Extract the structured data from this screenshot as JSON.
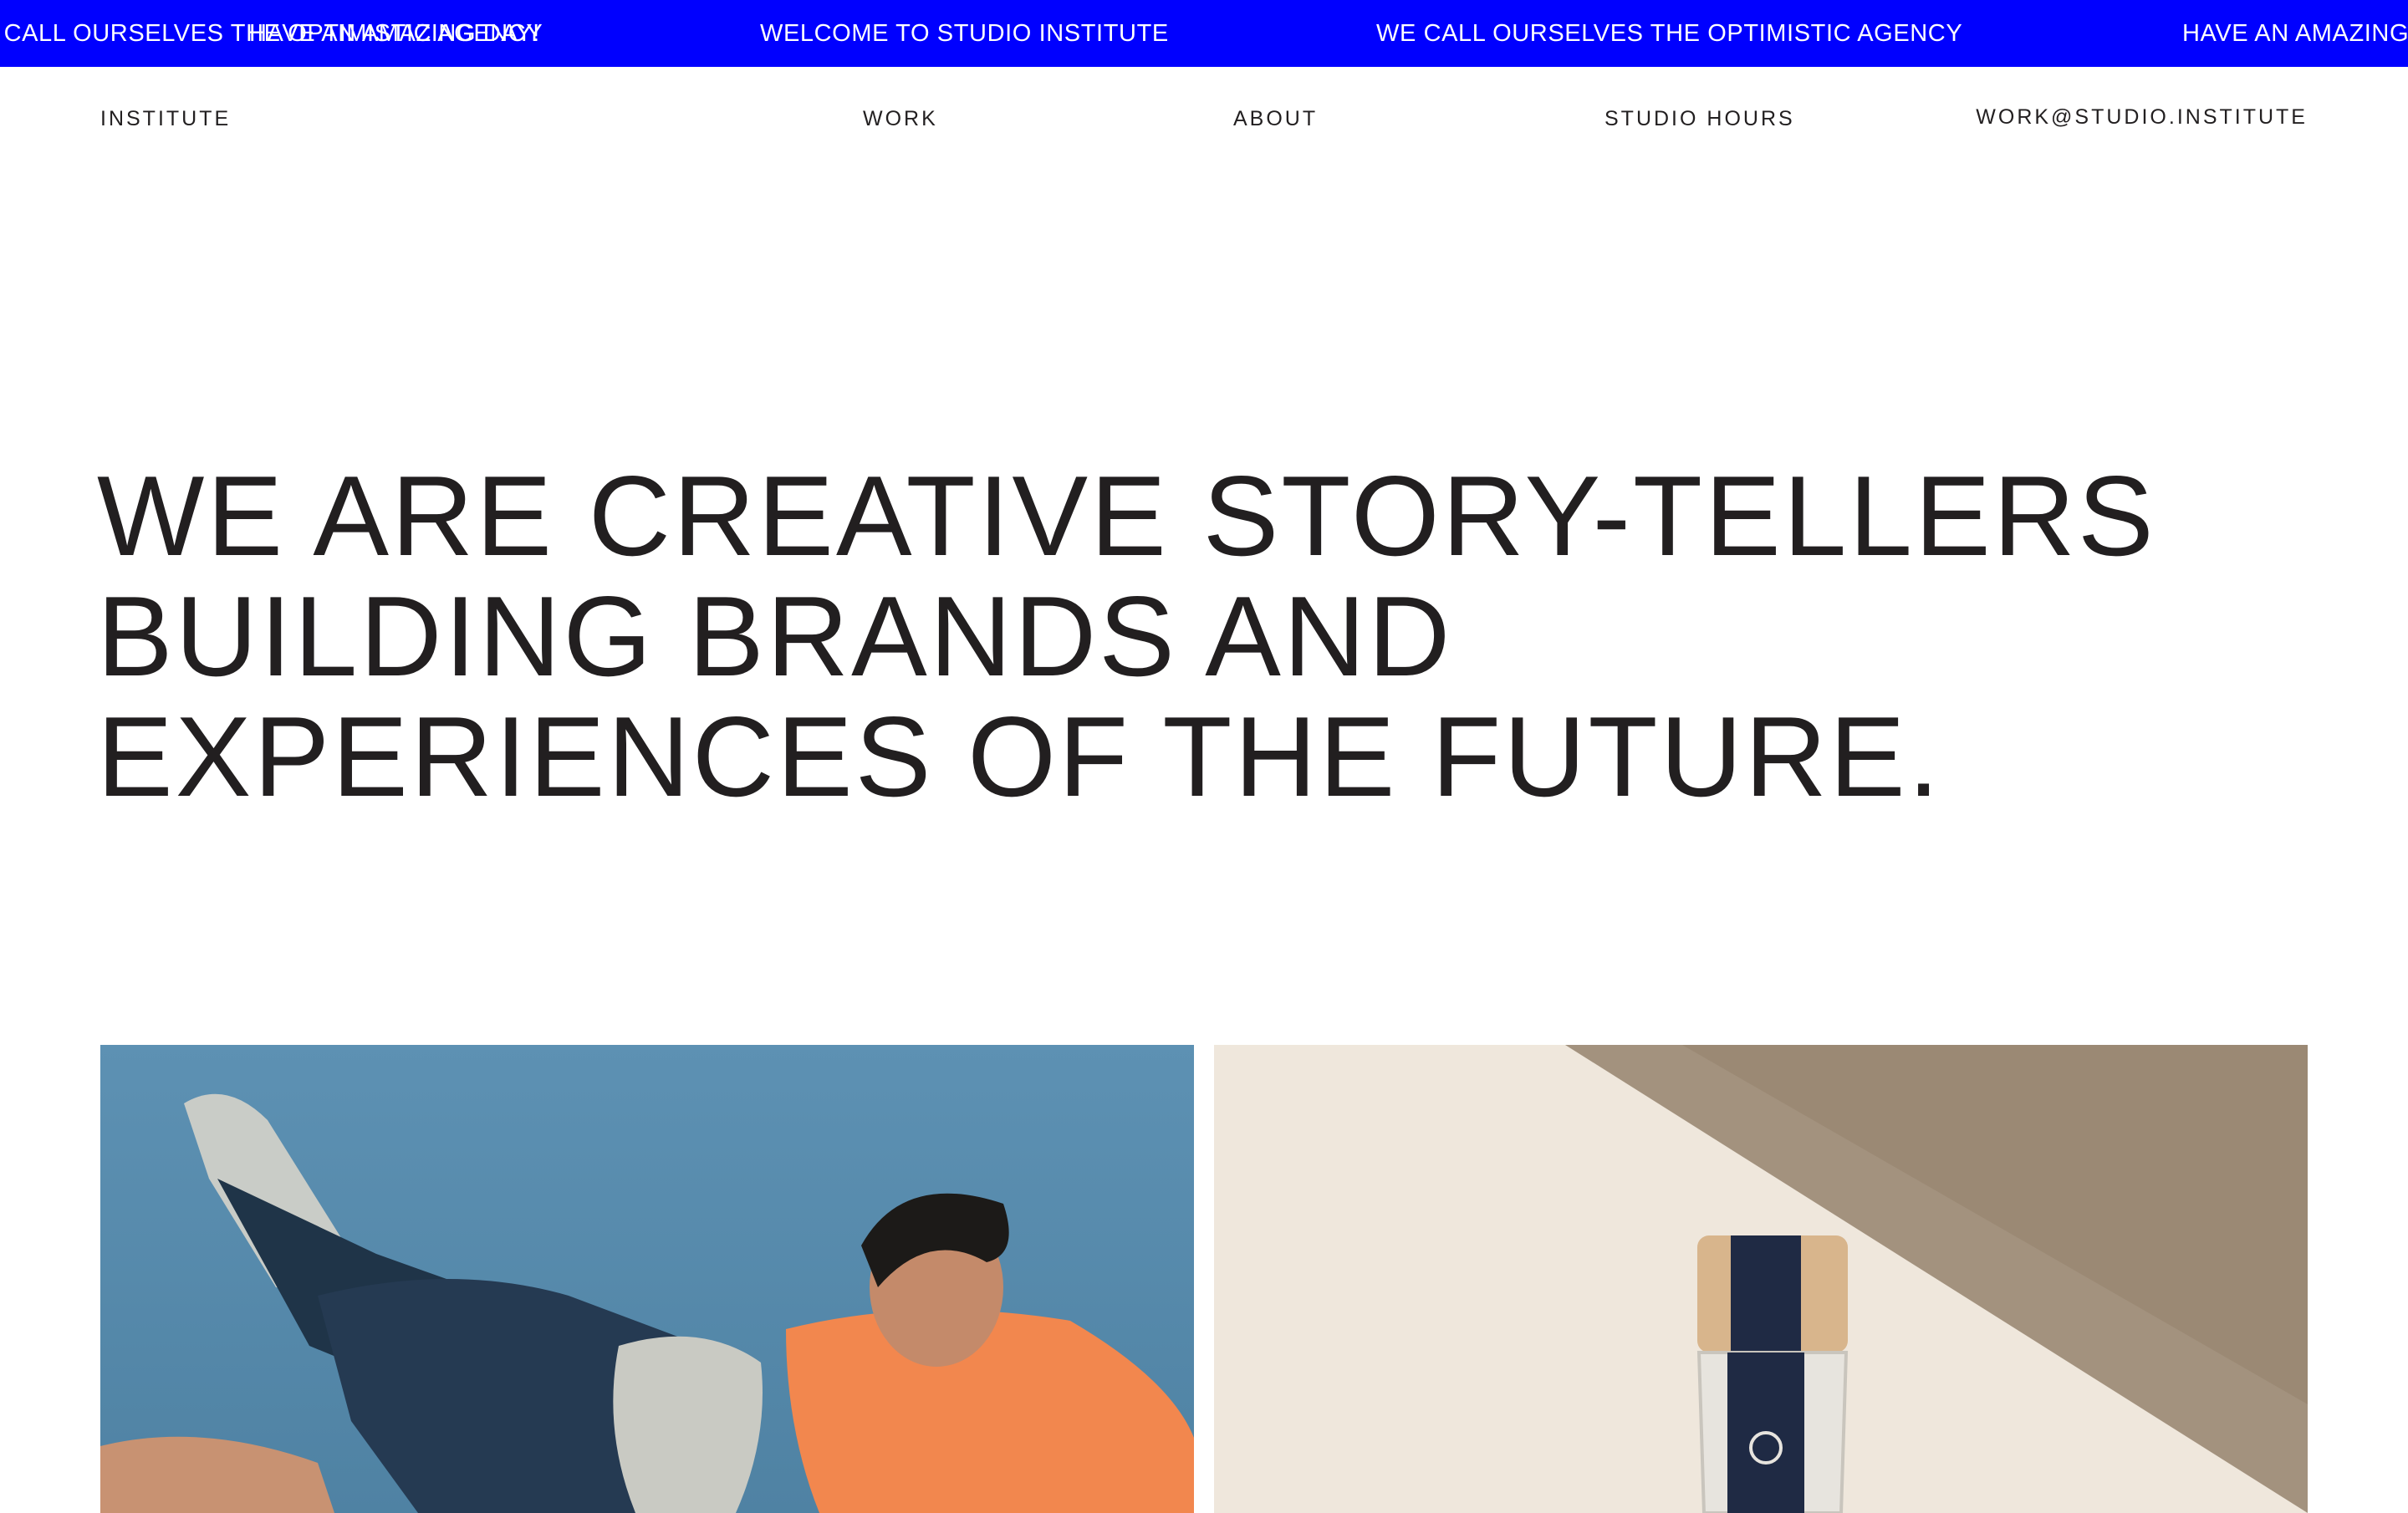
{
  "marquee": {
    "items": [
      "WE CALL OURSELVES THE OPTIMISTIC AGENCY",
      "HAVE AN AMAZING DAY!",
      "WELCOME TO STUDIO INSTITUTE",
      "WE CALL OURSELVES THE OPTIMISTIC AGENCY",
      "HAVE AN AMAZING DAY!"
    ]
  },
  "nav": {
    "logo": "INSTITUTE",
    "work": "WORK",
    "about": "ABOUT",
    "studio_hours": "STUDIO HOURS",
    "email": "WORK@STUDIO.INSTITUTE"
  },
  "hero": {
    "lines": [
      "WE ARE CREATIVE STORY-TELLERS",
      "BUILDING BRANDS AND",
      "EXPERIENCES OF THE FUTURE."
    ]
  },
  "colors": {
    "banner": "#0000ff",
    "text": "#221f20",
    "background": "#ffffff"
  },
  "projects": [
    {
      "image": "man-falling-sky-photo"
    },
    {
      "image": "glass-bottle-photo"
    }
  ]
}
